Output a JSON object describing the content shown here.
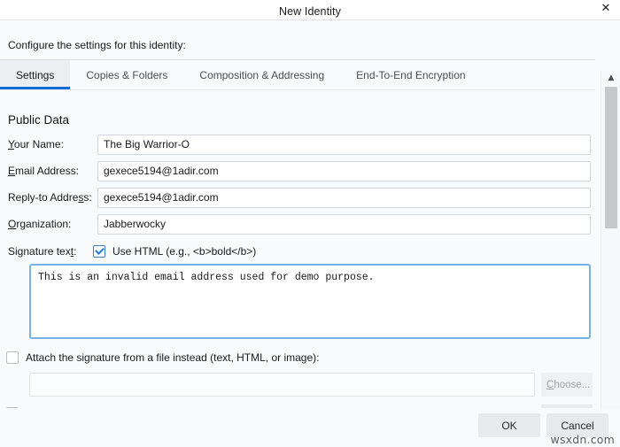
{
  "window": {
    "title": "New Identity",
    "close_icon": "close-icon"
  },
  "intro": {
    "text": "Configure the settings for this identity:"
  },
  "tabs": [
    {
      "label": "Settings",
      "active": true
    },
    {
      "label": "Copies & Folders",
      "active": false
    },
    {
      "label": "Composition & Addressing",
      "active": false
    },
    {
      "label": "End-To-End Encryption",
      "active": false
    }
  ],
  "section": {
    "title": "Public Data"
  },
  "fields": [
    {
      "label": "Your Name:",
      "accel": "Y",
      "value": "The Big Warrior-O",
      "placeholder": ""
    },
    {
      "label": "Email Address:",
      "accel": "E",
      "value": "gexece5194@1adir.com",
      "placeholder": ""
    },
    {
      "label": "Reply-to Address:",
      "accel": "s",
      "value": "gexece5194@1adir.com",
      "placeholder": ""
    },
    {
      "label": "Organization:",
      "accel": "O",
      "value": "Jabberwocky",
      "placeholder": ""
    }
  ],
  "signature": {
    "row_label": "Signature text:",
    "use_html_label": "Use HTML (e.g., <b>bold</b>)",
    "use_html_checked": true,
    "text": "This is an invalid email address used for demo purpose."
  },
  "attach": {
    "checkbox_label": "Attach the signature from a file instead (text, HTML, or image):",
    "checked": false,
    "path_value": "",
    "path_placeholder": "",
    "choose_label": "Choose..."
  },
  "scrollbar": {
    "up_arrow": "chevron-up-icon",
    "down_arrow": "chevron-down-icon"
  },
  "footer": {
    "ok_label": "OK",
    "cancel_label": "Cancel"
  },
  "watermark": {
    "text": "wsxdn.com"
  },
  "colors": {
    "accent": "#0a6cd4",
    "focus_border": "#73b3e7",
    "dialog_bg": "#f9fafb",
    "field_border": "#d3d6da"
  }
}
